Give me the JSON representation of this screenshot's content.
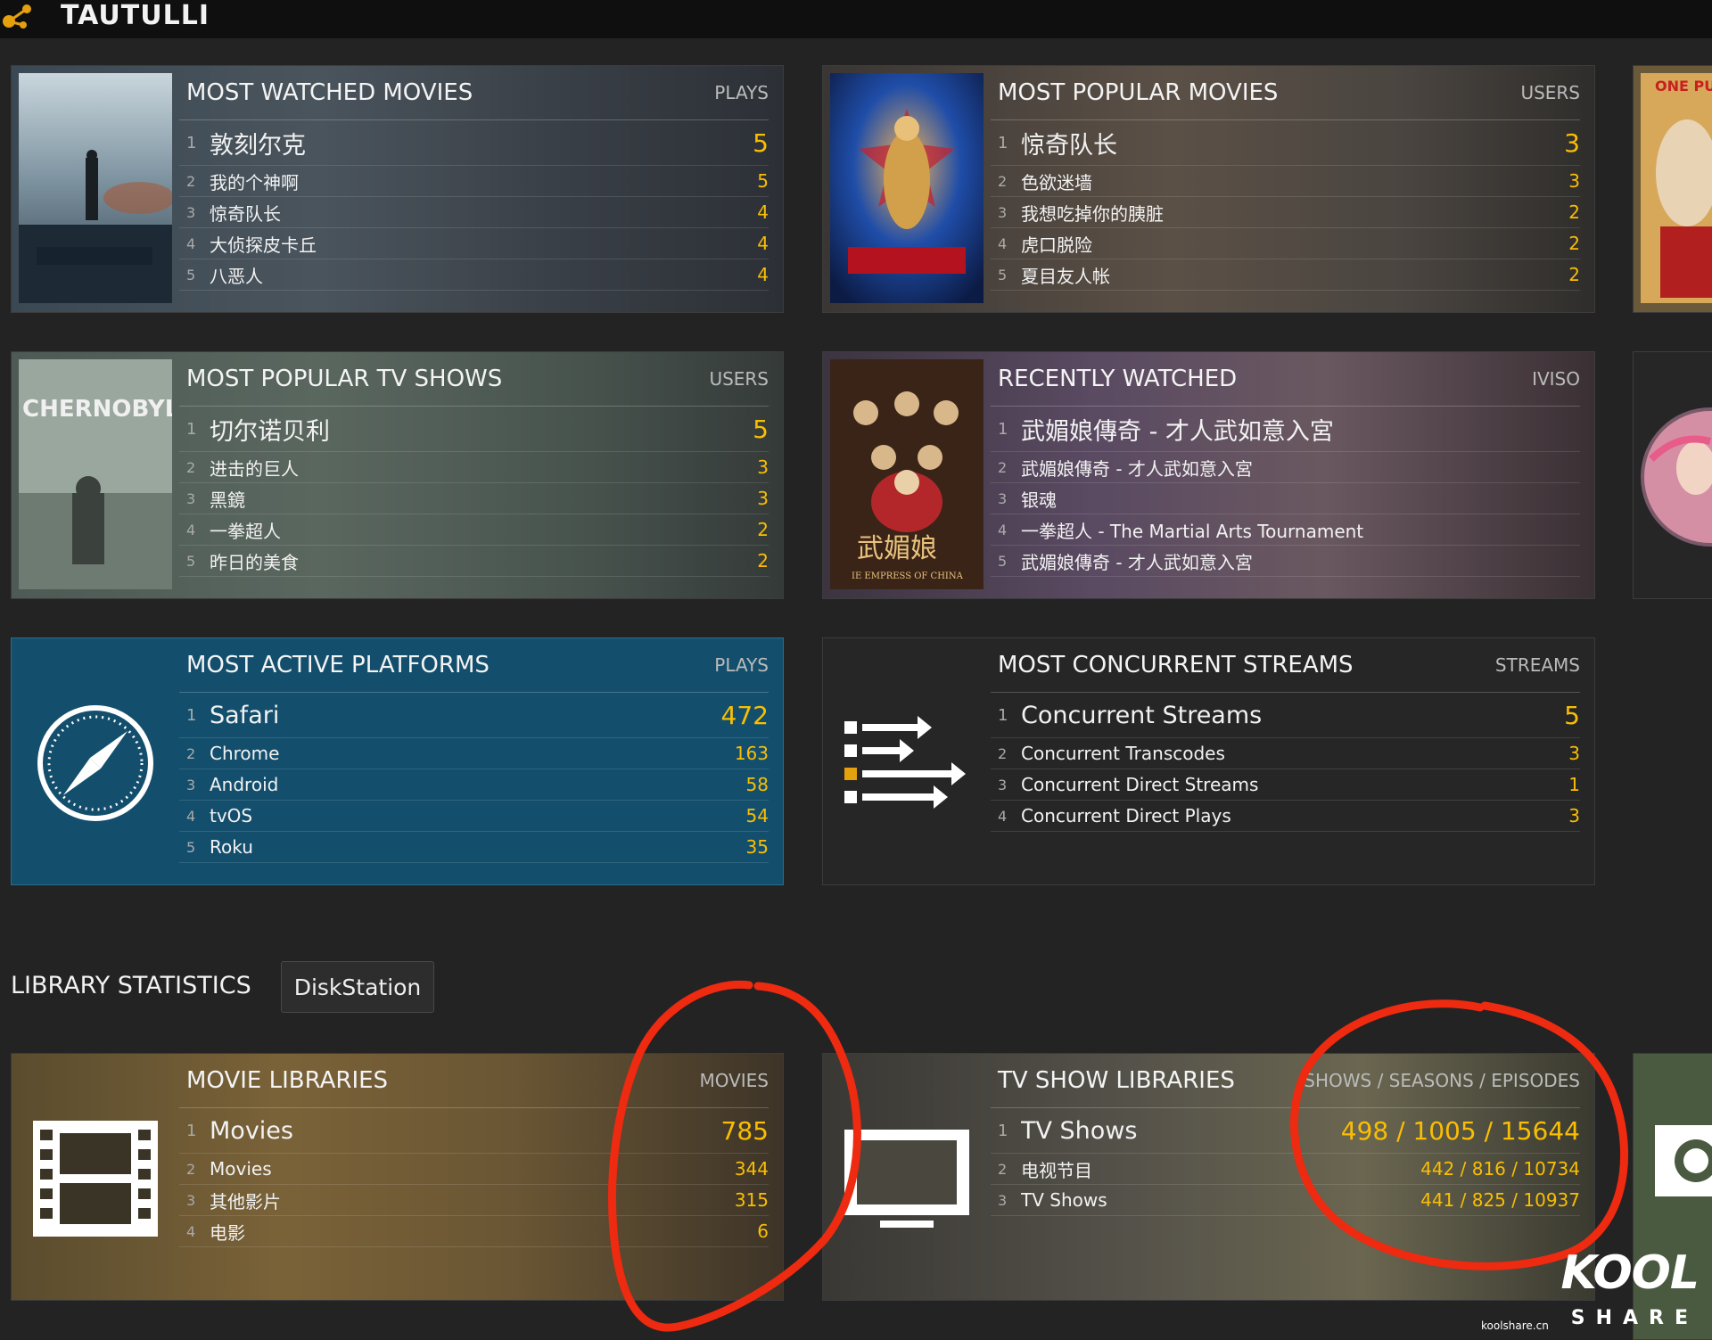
{
  "app": {
    "name": "TAUTULLI"
  },
  "cards": {
    "most_watched_movies": {
      "title": "MOST WATCHED MOVIES",
      "unit": "PLAYS",
      "rows": [
        {
          "rank": "1",
          "name": "敦刻尔克",
          "value": "5"
        },
        {
          "rank": "2",
          "name": "我的个神啊",
          "value": "5"
        },
        {
          "rank": "3",
          "name": "惊奇队长",
          "value": "4"
        },
        {
          "rank": "4",
          "name": "大侦探皮卡丘",
          "value": "4"
        },
        {
          "rank": "5",
          "name": "八恶人",
          "value": "4"
        }
      ]
    },
    "most_popular_movies": {
      "title": "MOST POPULAR MOVIES",
      "unit": "USERS",
      "rows": [
        {
          "rank": "1",
          "name": "惊奇队长",
          "value": "3"
        },
        {
          "rank": "2",
          "name": "色欲迷墙",
          "value": "3"
        },
        {
          "rank": "3",
          "name": "我想吃掉你的胰脏",
          "value": "2"
        },
        {
          "rank": "4",
          "name": "虎口脱险",
          "value": "2"
        },
        {
          "rank": "5",
          "name": "夏目友人帐",
          "value": "2"
        }
      ]
    },
    "most_popular_tv": {
      "title": "MOST POPULAR TV SHOWS",
      "unit": "USERS",
      "poster_text": "CHERNOBYL",
      "rows": [
        {
          "rank": "1",
          "name": "切尔诺贝利",
          "value": "5"
        },
        {
          "rank": "2",
          "name": "进击的巨人",
          "value": "3"
        },
        {
          "rank": "3",
          "name": "黑鏡",
          "value": "3"
        },
        {
          "rank": "4",
          "name": "一拳超人",
          "value": "2"
        },
        {
          "rank": "5",
          "name": "昨日的美食",
          "value": "2"
        }
      ]
    },
    "recently_watched": {
      "title": "RECENTLY WATCHED",
      "unit": "IVISO",
      "poster_text": "武媚娘",
      "poster_sub": "IE EMPRESS OF CHINA",
      "rows": [
        {
          "rank": "1",
          "name": "武媚娘傳奇 - 才人武如意入宮",
          "value": ""
        },
        {
          "rank": "2",
          "name": "武媚娘傳奇 - 才人武如意入宮",
          "value": ""
        },
        {
          "rank": "3",
          "name": "银魂",
          "value": ""
        },
        {
          "rank": "4",
          "name": "一拳超人 - The Martial Arts Tournament",
          "value": ""
        },
        {
          "rank": "5",
          "name": "武媚娘傳奇 - 才人武如意入宮",
          "value": ""
        }
      ]
    },
    "most_active_platforms": {
      "title": "MOST ACTIVE PLATFORMS",
      "unit": "PLAYS",
      "rows": [
        {
          "rank": "1",
          "name": "Safari",
          "value": "472"
        },
        {
          "rank": "2",
          "name": "Chrome",
          "value": "163"
        },
        {
          "rank": "3",
          "name": "Android",
          "value": "58"
        },
        {
          "rank": "4",
          "name": "tvOS",
          "value": "54"
        },
        {
          "rank": "5",
          "name": "Roku",
          "value": "35"
        }
      ]
    },
    "most_concurrent_streams": {
      "title": "MOST CONCURRENT STREAMS",
      "unit": "STREAMS",
      "rows": [
        {
          "rank": "1",
          "name": "Concurrent Streams",
          "value": "5"
        },
        {
          "rank": "2",
          "name": "Concurrent Transcodes",
          "value": "3"
        },
        {
          "rank": "3",
          "name": "Concurrent Direct Streams",
          "value": "1"
        },
        {
          "rank": "4",
          "name": "Concurrent Direct Plays",
          "value": "3"
        }
      ]
    },
    "movie_libraries": {
      "title": "MOVIE LIBRARIES",
      "unit": "MOVIES",
      "rows": [
        {
          "rank": "1",
          "name": "Movies",
          "value": "785"
        },
        {
          "rank": "2",
          "name": "Movies",
          "value": "344"
        },
        {
          "rank": "3",
          "name": "其他影片",
          "value": "315"
        },
        {
          "rank": "4",
          "name": "电影",
          "value": "6"
        }
      ]
    },
    "tv_show_libraries": {
      "title": "TV SHOW LIBRARIES",
      "unit": "SHOWS / SEASONS / EPISODES",
      "rows": [
        {
          "rank": "1",
          "name": "TV Shows",
          "value": "498 / 1005 / 15644"
        },
        {
          "rank": "2",
          "name": "电视节目",
          "value": "442 / 816 / 10734"
        },
        {
          "rank": "3",
          "name": "TV Shows",
          "value": "441 / 825 / 10937"
        }
      ]
    }
  },
  "peek": {
    "one_punch_text": "ONE PUN"
  },
  "library_statistics": {
    "label": "LIBRARY STATISTICS",
    "server_button": "DiskStation"
  },
  "watermark": {
    "logo": "KOOL",
    "sub": "SHARE",
    "url": "koolshare.cn"
  },
  "colors": {
    "accent": "#f9be03",
    "platform_bg": "#134f6d",
    "annotation": "#ee2a10"
  }
}
